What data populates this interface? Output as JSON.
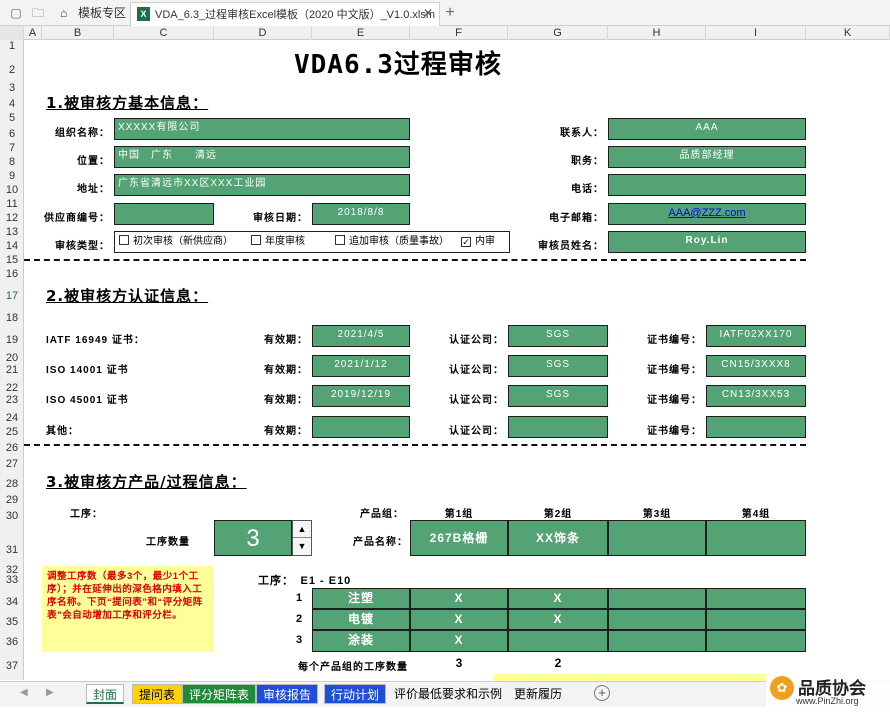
{
  "window": {
    "tab_home": "模板专区",
    "tab_file": "VDA_6.3_过程审核Excel模板（2020 中文版）_V1.0.xlsm",
    "new_tab": "+"
  },
  "columns": [
    "A",
    "B",
    "C",
    "D",
    "E",
    "F",
    "G",
    "H",
    "I",
    "K"
  ],
  "rows": [
    "1",
    "2",
    "3",
    "4",
    "5",
    "6",
    "7",
    "8",
    "9",
    "10",
    "11",
    "12",
    "13",
    "14",
    "15",
    "16",
    "17",
    "18",
    "19",
    "20",
    "21",
    "22",
    "23",
    "24",
    "25",
    "26",
    "27",
    "28",
    "29",
    "30",
    "31",
    "32",
    "33",
    "34",
    "35",
    "36",
    "37"
  ],
  "title": "VDA6.3过程审核",
  "s1": {
    "heading": "1.被审核方基本信息：",
    "org_label": "组织名称：",
    "org_value": "XXXXX有限公司",
    "loc_label": "位置：",
    "loc_value": "中国　广东　　清远",
    "addr_label": "地址：",
    "addr_value": "广东省清远市XX区XXX工业园",
    "supplier_label": "供应商编号：",
    "supplier_value": "",
    "date_label": "审核日期：",
    "date_value": "2018/8/8",
    "type_label": "审核类型：",
    "types": [
      {
        "label": "初次审核（新供应商）",
        "checked": ""
      },
      {
        "label": "年度审核",
        "checked": ""
      },
      {
        "label": "追加审核（质量事故）",
        "checked": ""
      },
      {
        "label": "内审",
        "checked": "✓"
      }
    ],
    "contact_label": "联系人：",
    "contact_value": "AAA",
    "duty_label": "职务：",
    "duty_value": "品质部经理",
    "phone_label": "电话：",
    "phone_value": "",
    "email_label": "电子邮箱：",
    "email_value": "AAA@ZZZ.com",
    "auditor_label": "审核员姓名：",
    "auditor_value": "Roy.Lin"
  },
  "s2": {
    "heading": "2.被审核方认证信息：",
    "valid_label": "有效期：",
    "company_label": "认证公司：",
    "cert_label": "证书编号：",
    "certs": [
      {
        "name": "IATF 16949 证书：",
        "valid": "2021/4/5",
        "company": "SGS",
        "no": "IATF02XX170"
      },
      {
        "name": "ISO 14001 证书",
        "valid": "2021/1/12",
        "company": "SGS",
        "no": "CN15/3XXX8"
      },
      {
        "name": "ISO 45001 证书",
        "valid": "2019/12/19",
        "company": "SGS",
        "no": "CN13/3XX53"
      },
      {
        "name": "其他：",
        "valid": "",
        "company": "",
        "no": ""
      }
    ]
  },
  "s3": {
    "heading": "3.被审核方产品/过程信息：",
    "process_label": "工序：",
    "process_count_label": "工序数量",
    "process_count": "3",
    "group_label": "产品组：",
    "groups": [
      "第1组",
      "第2组",
      "第3组",
      "第4组"
    ],
    "product_label": "产品名称：",
    "products": [
      "267B格栅",
      "XX饰条",
      "",
      ""
    ],
    "note": "调整工序数（最多3个，最少1个工序）；并在延伸出的深色格内填入工序名称。下页“提问表”和“评分矩阵表”会自动增加工序和评分栏。",
    "range_label": "工序：　E1 - E10",
    "processes": [
      {
        "no": "1",
        "name": "注塑",
        "marks": [
          "X",
          "X",
          "",
          ""
        ]
      },
      {
        "no": "2",
        "name": "电镀",
        "marks": [
          "X",
          "X",
          "",
          ""
        ]
      },
      {
        "no": "3",
        "name": "涂装",
        "marks": [
          "X",
          "",
          "",
          ""
        ]
      }
    ],
    "count_label": "每个产品组的工序数量",
    "counts": [
      "3",
      "2",
      "",
      ""
    ]
  },
  "sheets": [
    "封面",
    "提问表",
    "评分矩阵表",
    "审核报告",
    "行动计划",
    "评价最低要求和示例",
    "更新履历"
  ],
  "colors": {
    "green": "#53a374",
    "yellow": "#ffff99",
    "note_red": "#e00000"
  },
  "watermark": {
    "text": "品质协会",
    "url": "www.PinZhi.org"
  }
}
